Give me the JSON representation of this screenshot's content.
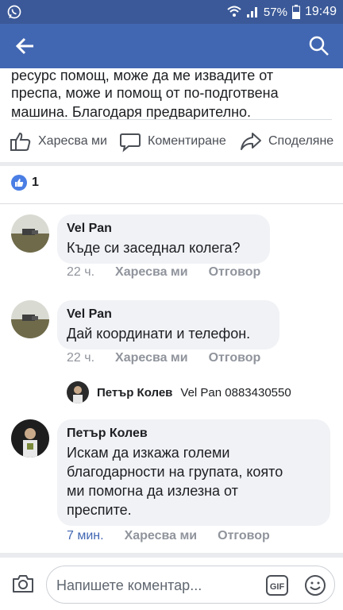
{
  "status_bar": {
    "battery": "57%",
    "time": "19:49"
  },
  "post": {
    "text_line1": "ресурс помощ, може да ме извадите от",
    "text_line2": "преспа, може и помощ от по-подготвена",
    "text_line3": "машина. Благодаря предварително."
  },
  "actions": {
    "like": "Харесва ми",
    "comment": "Коментиране",
    "share": "Споделяне"
  },
  "reactions": {
    "count": "1"
  },
  "comments": [
    {
      "author": "Vel Pan",
      "text": "Къде си заседнал колега?",
      "time": "22 ч.",
      "like": "Харесва ми",
      "reply": "Отговор"
    },
    {
      "author": "Vel Pan",
      "text": "Дай координати и телефон.",
      "time": "22 ч.",
      "like": "Харесва ми",
      "reply": "Отговор"
    },
    {
      "author": "Петър Колев",
      "text_lines": [
        "Искам да изкажа големи",
        "благодарности на групата, която",
        "ми помогна да излезна от",
        "преспите."
      ],
      "time": "7 мин.",
      "like": "Харесва ми",
      "reply": "Отговор"
    }
  ],
  "reply_preview": {
    "author": "Петър Колев",
    "text": "Vel Pan 0883430550"
  },
  "composer": {
    "placeholder": "Напишете коментар..."
  },
  "colors": {
    "header": "#4267b2",
    "status_bar": "#3b5998",
    "like_badge": "#4a7ee4"
  }
}
